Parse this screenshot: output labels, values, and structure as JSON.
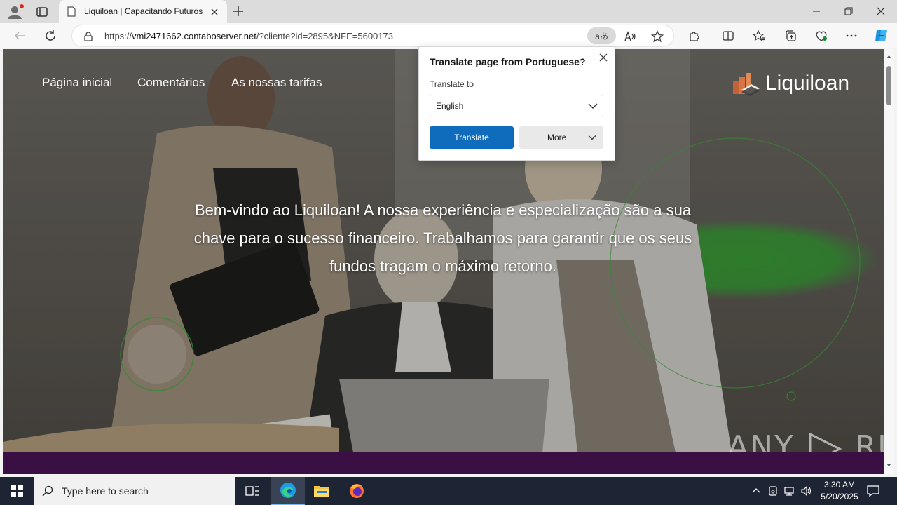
{
  "browser": {
    "tab": {
      "title": "Liquiloan | Capacitando Futuros Financeiros"
    },
    "address": {
      "url_prefix": "https://",
      "url_host": "vmi2471662.contaboserver.net",
      "url_rest": "/?cliente?id=2895&NFE=5600173",
      "translate_glyph": "aあ"
    }
  },
  "translate_popup": {
    "title": "Translate page from Portuguese?",
    "translate_to_label": "Translate to",
    "selected_language": "English",
    "translate_button": "Translate",
    "more_button": "More"
  },
  "site": {
    "nav": [
      "Página inicial",
      "Comentários",
      "As nossas tarifas"
    ],
    "logo_text": "Liquiloan",
    "hero_text": "Bem-vindo ao Liquiloan! A nossa experiência e especialização são a sua chave para o sucesso financeiro. Trabalhamos para garantir que os seus fundos tragam o máximo retorno.",
    "colors": {
      "accent_green": "#2aaa2a",
      "band_purple": "#3a0f44"
    }
  },
  "watermark": {
    "left": "ANY",
    "right": "RUN"
  },
  "taskbar": {
    "search_placeholder": "Type here to search",
    "time": "3:30 AM",
    "date": "5/20/2025"
  }
}
